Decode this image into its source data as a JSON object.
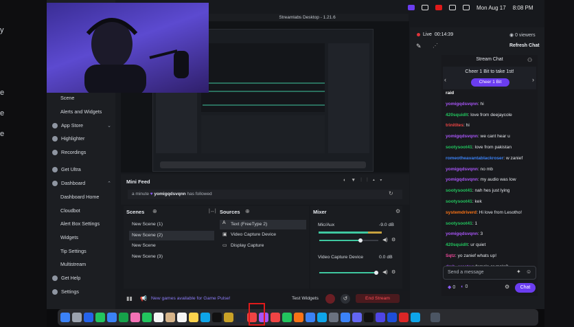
{
  "menubar": {
    "date": "Mon Aug 17",
    "time": "8:08 PM"
  },
  "preview": {
    "title": "Streamlabs Desktop - 1.21.6"
  },
  "stream": {
    "live_label": "Live",
    "live_time": "00:14:39",
    "viewers": "0 viewers",
    "refresh_chat": "Refresh Chat"
  },
  "chat": {
    "title": "Stream Chat",
    "cheer_text": "Cheer 1 Bit to take 1st!",
    "cheer_button": "Cheer 1 Bit",
    "messages": [
      {
        "user": "raid",
        "text": "",
        "color": "#ffffff"
      },
      {
        "user": "yomigqdsvqnn",
        "text": ": hi",
        "color": "#a855f7"
      },
      {
        "user": "420squidlt",
        "text": ": love from deejaycole",
        "color": "#22c55e"
      },
      {
        "user": "trinitites",
        "text": ": hi",
        "color": "#ef4444"
      },
      {
        "user": "yomigqdsvqnn",
        "text": ": we cant hear u",
        "color": "#a855f7"
      },
      {
        "user": "sootysoot41",
        "text": ": love from pakistan",
        "color": "#22c55e"
      },
      {
        "user": "romeotheavantablackroser",
        "text": ": w zanief",
        "color": "#3b82f6"
      },
      {
        "user": "yomigqdsvqnn",
        "text": ": no mb",
        "color": "#a855f7"
      },
      {
        "user": "yomigqdsvqnn",
        "text": ": my audio was low",
        "color": "#a855f7"
      },
      {
        "user": "sootysoot41",
        "text": ": nah hes just lying",
        "color": "#22c55e"
      },
      {
        "user": "sootysoot41",
        "text": ": kek",
        "color": "#22c55e"
      },
      {
        "user": "systemdriverd",
        "text": ": Hi love from Lesotho!",
        "color": "#f97316"
      },
      {
        "user": "sootysoot41",
        "text": ": 1",
        "color": "#22c55e"
      },
      {
        "user": "yomigqdsvqnn",
        "text": ": 3",
        "color": "#a855f7"
      },
      {
        "user": "420squidlt",
        "text": ": ur quiet",
        "color": "#22c55e"
      },
      {
        "user": "Sqtz",
        "text": ": yo zanief whats up!",
        "color": "#ec4899"
      },
      {
        "user": "dmb_creator",
        "text": ": female or male?",
        "color": "#a855f7"
      }
    ],
    "input_placeholder": "Send a message",
    "bits": "0",
    "points": "0",
    "chat_button": "Chat"
  },
  "sidebar": {
    "items": [
      {
        "label": "Scene"
      },
      {
        "label": "Alerts and Widgets"
      },
      {
        "label": "App Store"
      },
      {
        "label": "Highlighter"
      },
      {
        "label": "Recordings"
      },
      {
        "label": "Get Ultra"
      },
      {
        "label": "Dashboard"
      },
      {
        "label": "Dashboard Home"
      },
      {
        "label": "Cloudbot"
      },
      {
        "label": "Alert Box Settings"
      },
      {
        "label": "Widgets"
      },
      {
        "label": "Tip Settings"
      },
      {
        "label": "Multistream"
      },
      {
        "label": "Get Help"
      },
      {
        "label": "Settings"
      }
    ]
  },
  "minifeed": {
    "title": "Mini Feed",
    "time": "a minute",
    "user": "yomigqdsvqnn",
    "event": "has followed"
  },
  "scenes": {
    "title": "Scenes",
    "items": [
      "New Scene (1)",
      "New Scene (2)",
      "New Scene",
      "New Scene (3)"
    ]
  },
  "sources": {
    "title": "Sources",
    "items": [
      "Text (FreeType 2)",
      "Video Capture Device",
      "Display Capture"
    ]
  },
  "mixer": {
    "title": "Mixer",
    "channels": [
      {
        "name": "Mic/Aux",
        "db": "-9.0 dB",
        "level": 0.7
      },
      {
        "name": "Video Capture Device",
        "db": "0.0 dB",
        "level": 0.96
      }
    ]
  },
  "footer": {
    "pulse": "New games available for Game Pulse!",
    "test_widgets": "Test Widgets",
    "end_stream": "End Stream"
  },
  "outer_left": {
    "glyphs": [
      "y",
      "e",
      "e",
      "e"
    ]
  }
}
